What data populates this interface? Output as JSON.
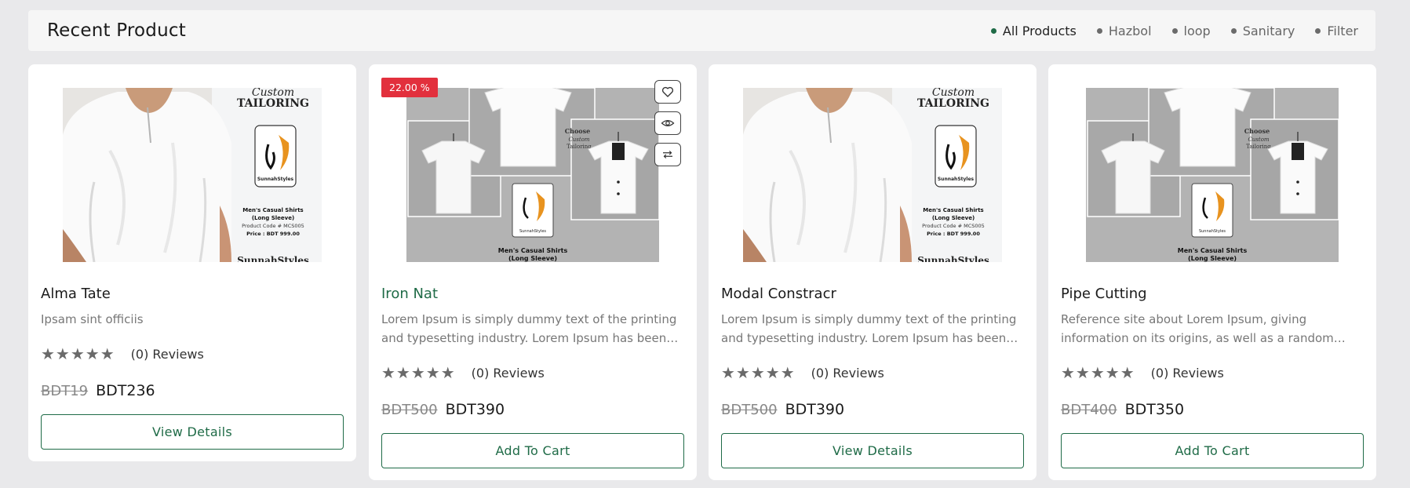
{
  "section": {
    "title": "Recent Product",
    "filters": [
      {
        "label": "All Products",
        "active": true
      },
      {
        "label": "Hazbol",
        "active": false
      },
      {
        "label": "loop",
        "active": false
      },
      {
        "label": "Sanitary",
        "active": false
      },
      {
        "label": "Filter",
        "active": false
      }
    ]
  },
  "products": [
    {
      "title": "Alma Tate",
      "description": "Ipsam sint officiis",
      "stars": "★★★★★",
      "reviews": "(0) Reviews",
      "old_price": "BDT19",
      "new_price": "BDT236",
      "button": "View Details"
    },
    {
      "title": "Iron Nat",
      "description": "Lorem Ipsum is simply dummy text of the printing and typesetting industry. Lorem Ipsum has been the industry's standard dummy text",
      "stars": "★★★★★",
      "reviews": "(0) Reviews",
      "old_price": "BDT500",
      "new_price": "BDT390",
      "button": "Add To Cart",
      "badge": "22.00 %"
    },
    {
      "title": "Modal Constracr",
      "description": "Lorem Ipsum is simply dummy text of the printing and typesetting industry. Lorem Ipsum has been the industry's standard dummy text",
      "stars": "★★★★★",
      "reviews": "(0) Reviews",
      "old_price": "BDT500",
      "new_price": "BDT390",
      "button": "View Details"
    },
    {
      "title": "Pipe Cutting",
      "description": "Reference site about Lorem Ipsum, giving information on its origins, as well as a random generator",
      "stars": "★★★★★",
      "reviews": "(0) Reviews",
      "old_price": "BDT400",
      "new_price": "BDT350",
      "button": "Add To Cart"
    }
  ],
  "image_text": {
    "tailoring_top": "Custom",
    "tailoring_main": "TAILORING",
    "brand": "SunnahStyles",
    "shirt_title": "Men's Casual Shirts",
    "shirt_sub": "(Long Sleeve)",
    "product_code": "Product Code # MCS005",
    "price_line": "Price : BDT 999.00",
    "choose": "Choose",
    "choose_sub": "Custom",
    "choose_sub2": "Tailoring"
  },
  "icons": [
    "heart-icon",
    "eye-icon",
    "compare-icon"
  ],
  "colors": {
    "accent": "#1f6b47",
    "badge": "#e2303d"
  }
}
